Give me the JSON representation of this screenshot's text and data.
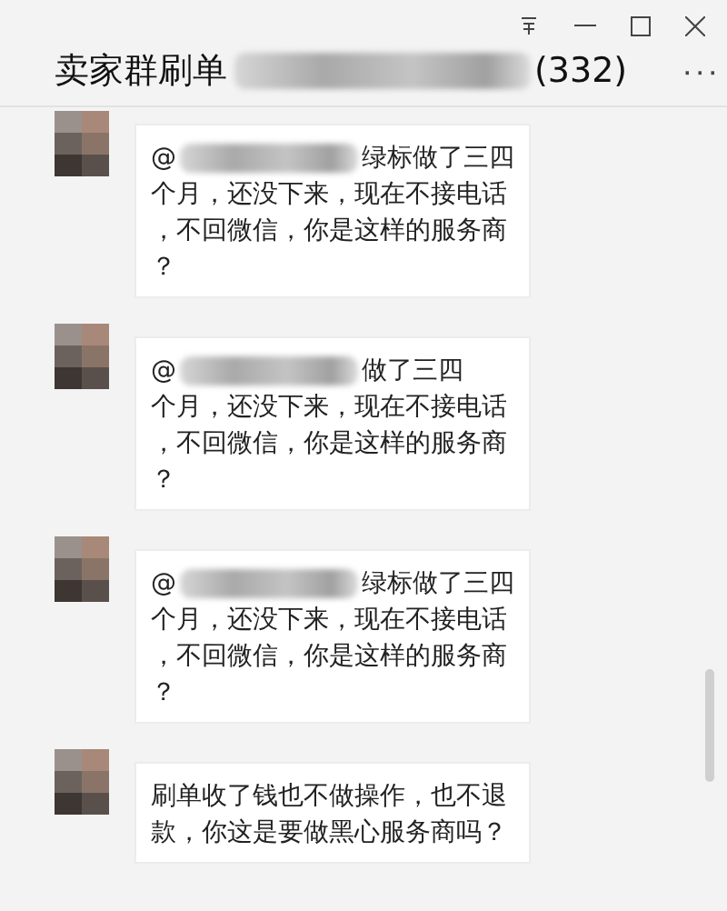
{
  "window": {
    "title": "卖家群刷单",
    "member_count": "(332)",
    "more": "···"
  },
  "messages": [
    {
      "mention": "@",
      "redacted": true,
      "lines": [
        "绿标做了三四",
        "个月，还没下来，现在不接电话",
        "，不回微信，你是这样的服务商",
        "？"
      ]
    },
    {
      "mention": "@",
      "redacted": true,
      "lines": [
        "做了三四",
        "个月，还没下来，现在不接电话",
        "，不回微信，你是这样的服务商",
        "？"
      ]
    },
    {
      "mention": "@",
      "redacted": true,
      "lines": [
        "绿标做了三四",
        "个月，还没下来，现在不接电话",
        "，不回微信，你是这样的服务商",
        "？"
      ]
    },
    {
      "redacted": false,
      "lines": [
        "刷单收了钱也不做操作，也不退",
        "款，你这是要做黑心服务商吗？"
      ]
    }
  ]
}
